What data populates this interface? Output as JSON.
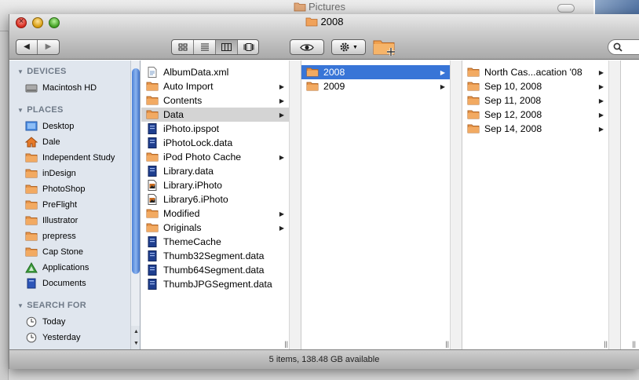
{
  "background_window": {
    "title": "Pictures"
  },
  "window": {
    "title": "2008"
  },
  "toolbar": {
    "back_glyph": "◀",
    "forward_glyph": "▶",
    "views": [
      "icon-view-icon",
      "list-view-icon",
      "column-view-icon",
      "coverflow-view-icon"
    ],
    "active_view": "column-view-icon",
    "quicklook_icon": "eye-icon",
    "action_icon": "gear-icon",
    "new_folder_icon": "new-folder-icon",
    "search_placeholder": ""
  },
  "sidebar": {
    "sections": [
      {
        "label": "DEVICES",
        "items": [
          {
            "label": "Macintosh HD",
            "icon": "hard-drive-icon"
          }
        ]
      },
      {
        "label": "PLACES",
        "items": [
          {
            "label": "Desktop",
            "icon": "desktop-icon"
          },
          {
            "label": "Dale",
            "icon": "home-icon"
          },
          {
            "label": "Independent Study",
            "icon": "folder-icon"
          },
          {
            "label": "inDesign",
            "icon": "folder-icon"
          },
          {
            "label": "PhotoShop",
            "icon": "folder-icon"
          },
          {
            "label": "PreFlight",
            "icon": "folder-icon"
          },
          {
            "label": "Illustrator",
            "icon": "folder-icon"
          },
          {
            "label": "prepress",
            "icon": "folder-icon"
          },
          {
            "label": "Cap Stone",
            "icon": "folder-icon"
          },
          {
            "label": "Applications",
            "icon": "applications-icon"
          },
          {
            "label": "Documents",
            "icon": "documents-icon"
          }
        ]
      },
      {
        "label": "SEARCH FOR",
        "items": [
          {
            "label": "Today",
            "icon": "clock-icon"
          },
          {
            "label": "Yesterday",
            "icon": "clock-icon"
          }
        ]
      }
    ]
  },
  "columns": [
    {
      "items": [
        {
          "label": "AlbumData.xml",
          "icon": "xml-file-icon",
          "has_children": false
        },
        {
          "label": "Auto Import",
          "icon": "folder-icon",
          "has_children": true
        },
        {
          "label": "Contents",
          "icon": "folder-icon",
          "has_children": true
        },
        {
          "label": "Data",
          "icon": "folder-icon",
          "has_children": true,
          "selected": true
        },
        {
          "label": "iPhoto.ipspot",
          "icon": "data-file-icon",
          "has_children": false
        },
        {
          "label": "iPhotoLock.data",
          "icon": "data-file-icon",
          "has_children": false
        },
        {
          "label": "iPod Photo Cache",
          "icon": "folder-icon",
          "has_children": true
        },
        {
          "label": "Library.data",
          "icon": "data-file-icon",
          "has_children": false
        },
        {
          "label": "Library.iPhoto",
          "icon": "iphoto-file-icon",
          "has_children": false
        },
        {
          "label": "Library6.iPhoto",
          "icon": "iphoto-file-icon",
          "has_children": false
        },
        {
          "label": "Modified",
          "icon": "folder-icon",
          "has_children": true
        },
        {
          "label": "Originals",
          "icon": "folder-icon",
          "has_children": true
        },
        {
          "label": "ThemeCache",
          "icon": "data-file-icon",
          "has_children": false
        },
        {
          "label": "Thumb32Segment.data",
          "icon": "data-file-icon",
          "has_children": false
        },
        {
          "label": "Thumb64Segment.data",
          "icon": "data-file-icon",
          "has_children": false
        },
        {
          "label": "ThumbJPGSegment.data",
          "icon": "data-file-icon",
          "has_children": false
        }
      ]
    },
    {
      "items": [
        {
          "label": "2008",
          "icon": "folder-icon",
          "has_children": true,
          "selected": true
        },
        {
          "label": "2009",
          "icon": "folder-icon",
          "has_children": true
        }
      ]
    },
    {
      "items": [
        {
          "label": "North Cas...acation '08",
          "icon": "folder-icon",
          "has_children": true
        },
        {
          "label": "Sep 10, 2008",
          "icon": "folder-icon",
          "has_children": true
        },
        {
          "label": "Sep 11, 2008",
          "icon": "folder-icon",
          "has_children": true
        },
        {
          "label": "Sep 12, 2008",
          "icon": "folder-icon",
          "has_children": true
        },
        {
          "label": "Sep 14, 2008",
          "icon": "folder-icon",
          "has_children": true
        }
      ]
    }
  ],
  "status": {
    "text": "5 items, 138.48 GB available"
  },
  "colors": {
    "selection_blue": "#3875d7",
    "selection_gray": "#d4d4d4",
    "sidebar_bg": "#e0e6ee",
    "folder": "#e8964a"
  }
}
